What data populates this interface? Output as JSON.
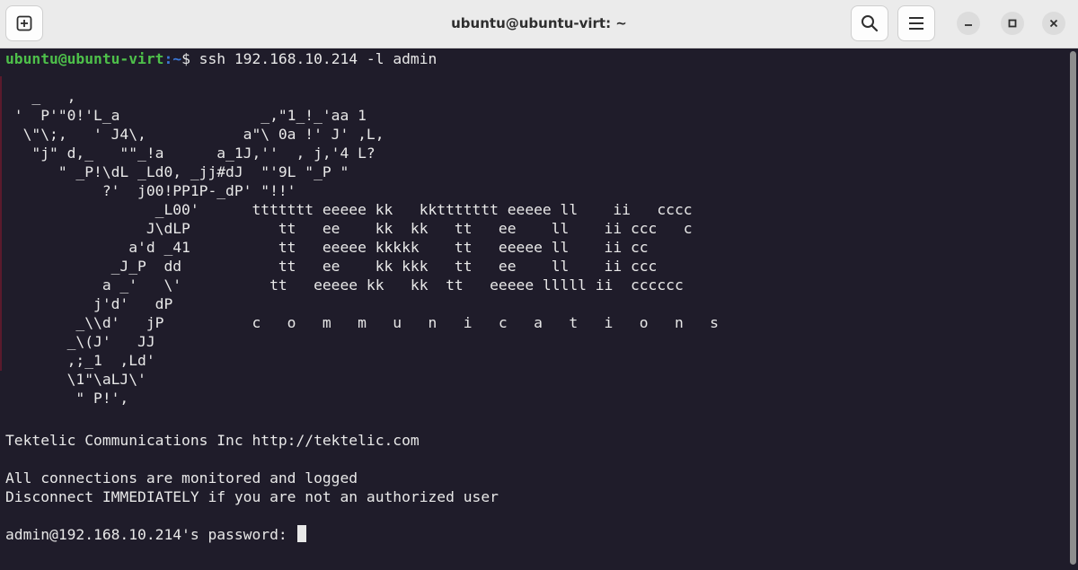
{
  "window": {
    "title": "ubuntu@ubuntu-virt: ~",
    "new_tab_icon": "plus-square-icon",
    "search_icon": "search-icon",
    "menu_icon": "hamburger-menu-icon"
  },
  "terminal": {
    "prompt_user_host": "ubuntu@ubuntu-virt",
    "prompt_path": ":~",
    "prompt_symbol": "$ ",
    "command": "ssh 192.168.10.214 -l admin",
    "banner": [
      "   _   ,",
      " '  P'\"0!'L_a                _,\"1_!_'aa 1",
      "  \\\"\\;,   ' J4\\,           a\"\\ 0a !' J' ,L,",
      "   \"j\" d,_   \"\"_!a      a_1J,''  , j,'4 L?",
      "      \" _P!\\dL _Ld0, _jj#dJ  \"'9L \"_P \"",
      "           ?'  j00!PP1P-_dP' \"!!'",
      "                 _L00'      ttttttt eeeee kk   kkttttttt eeeee ll    ii   cccc",
      "                J\\dLP          tt   ee    kk  kk   tt   ee    ll    ii ccc   c",
      "              a'd _41          tt   eeeee kkkkk    tt   eeeee ll    ii cc",
      "            _J_P  dd           tt   ee    kk kkk   tt   ee    ll    ii ccc",
      "           a _'   \\'          tt   eeeee kk   kk  tt   eeeee lllll ii  cccccc",
      "          j'd'   dP",
      "        _\\\\d'   jP          c   o   m   m   u   n   i   c   a   t   i   o   n   s",
      "       _\\(J'   JJ",
      "       ,;_1  ,Ld'",
      "       \\1\"\\aLJ\\'",
      "        \" P!',"
    ],
    "company_line": "Tektelic Communications Inc http://tektelic.com",
    "warning_line1": "All connections are monitored and logged",
    "warning_line2": "Disconnect IMMEDIATELY if you are not an authorized user",
    "password_prompt": "admin@192.168.10.214's password: ",
    "colors": {
      "background": "#1f1c2a",
      "text": "#e8e8e8",
      "prompt_user": "#4ec04a",
      "prompt_path": "#3b78d8"
    }
  }
}
